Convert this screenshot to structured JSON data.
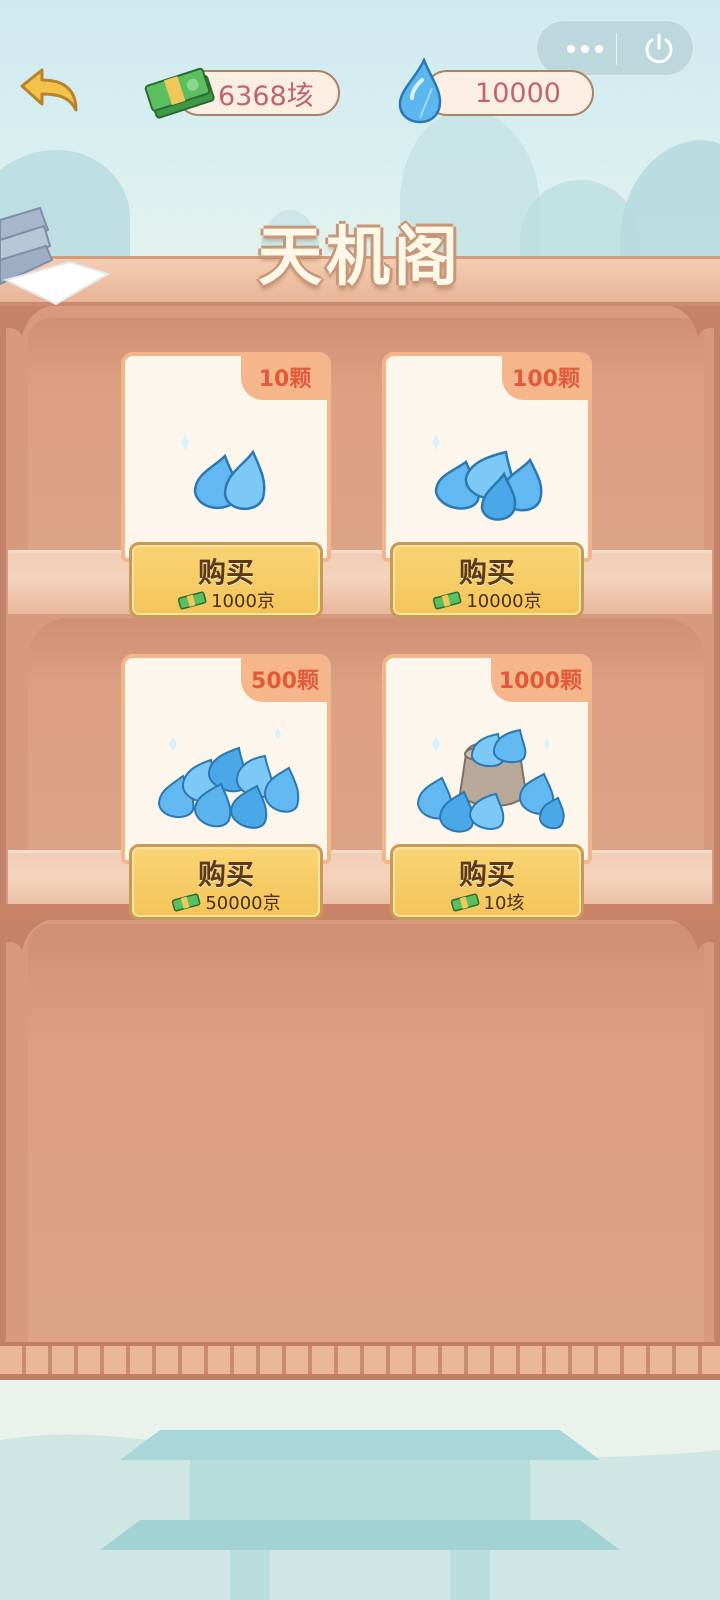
{
  "header": {
    "coin_amount": "6368垓",
    "water_amount": "10000",
    "title": "天机阁"
  },
  "icons": {
    "back": "back-arrow-icon",
    "coin": "cash-stack-icon",
    "water": "water-drop-icon",
    "more": "more-dots-icon",
    "power": "power-icon",
    "side": "location-icon"
  },
  "products": [
    {
      "quantity": "10颗",
      "buy_label": "购买",
      "price": "1000京"
    },
    {
      "quantity": "100颗",
      "buy_label": "购买",
      "price": "10000京"
    },
    {
      "quantity": "500颗",
      "buy_label": "购买",
      "price": "50000京"
    },
    {
      "quantity": "1000颗",
      "buy_label": "购买",
      "price": "10垓"
    }
  ],
  "colors": {
    "quantity_text": "#e15a3c",
    "button_fill": "#f4c45a",
    "cabinet": "#d69b7f"
  }
}
